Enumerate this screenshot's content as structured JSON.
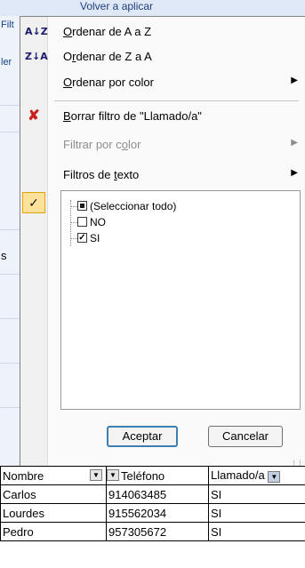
{
  "background": {
    "ribbon_text": "Volver a aplicar",
    "left_labels": [
      "Filt",
      "ler",
      "s"
    ]
  },
  "menu": {
    "items": [
      {
        "icon": "sort-ascending-icon",
        "glyph": "A↓Z",
        "pre": "",
        "u": "O",
        "post": "rdenar de A a Z",
        "disabled": false,
        "submenu": false
      },
      {
        "icon": "sort-descending-icon",
        "glyph": "Z↓A",
        "pre": "O",
        "u": "r",
        "post": "denar de Z a A",
        "disabled": false,
        "submenu": false
      },
      {
        "icon": "",
        "glyph": "",
        "pre": "",
        "u": "O",
        "post": "rdenar por color",
        "disabled": false,
        "submenu": true
      },
      {
        "icon": "clear-filter-icon",
        "glyph": "✘",
        "pre": "",
        "u": "B",
        "post": "orrar filtro de \"Llamado/a\"",
        "disabled": false,
        "submenu": false
      },
      {
        "icon": "",
        "glyph": "",
        "pre": "Filtrar por c",
        "u": "o",
        "post": "lor",
        "disabled": true,
        "submenu": true
      },
      {
        "icon": "",
        "glyph": "",
        "pre": "Filtros de ",
        "u": "t",
        "post": "exto",
        "disabled": false,
        "submenu": true
      }
    ],
    "filter_check": "✓",
    "checklist": [
      {
        "label": "(Seleccionar todo)",
        "state": "partial"
      },
      {
        "label": "NO",
        "state": "unchecked"
      },
      {
        "label": "SI",
        "state": "checked"
      }
    ],
    "ok_button": "Aceptar",
    "cancel_button": "Cancelar"
  },
  "table": {
    "headers": [
      "Nombre",
      "Teléfono",
      "Llamado/a"
    ],
    "rows": [
      [
        "Carlos",
        "914063485",
        "SI"
      ],
      [
        "Lourdes",
        "915562034",
        "SI"
      ],
      [
        "Pedro",
        "957305672",
        "SI"
      ]
    ]
  }
}
